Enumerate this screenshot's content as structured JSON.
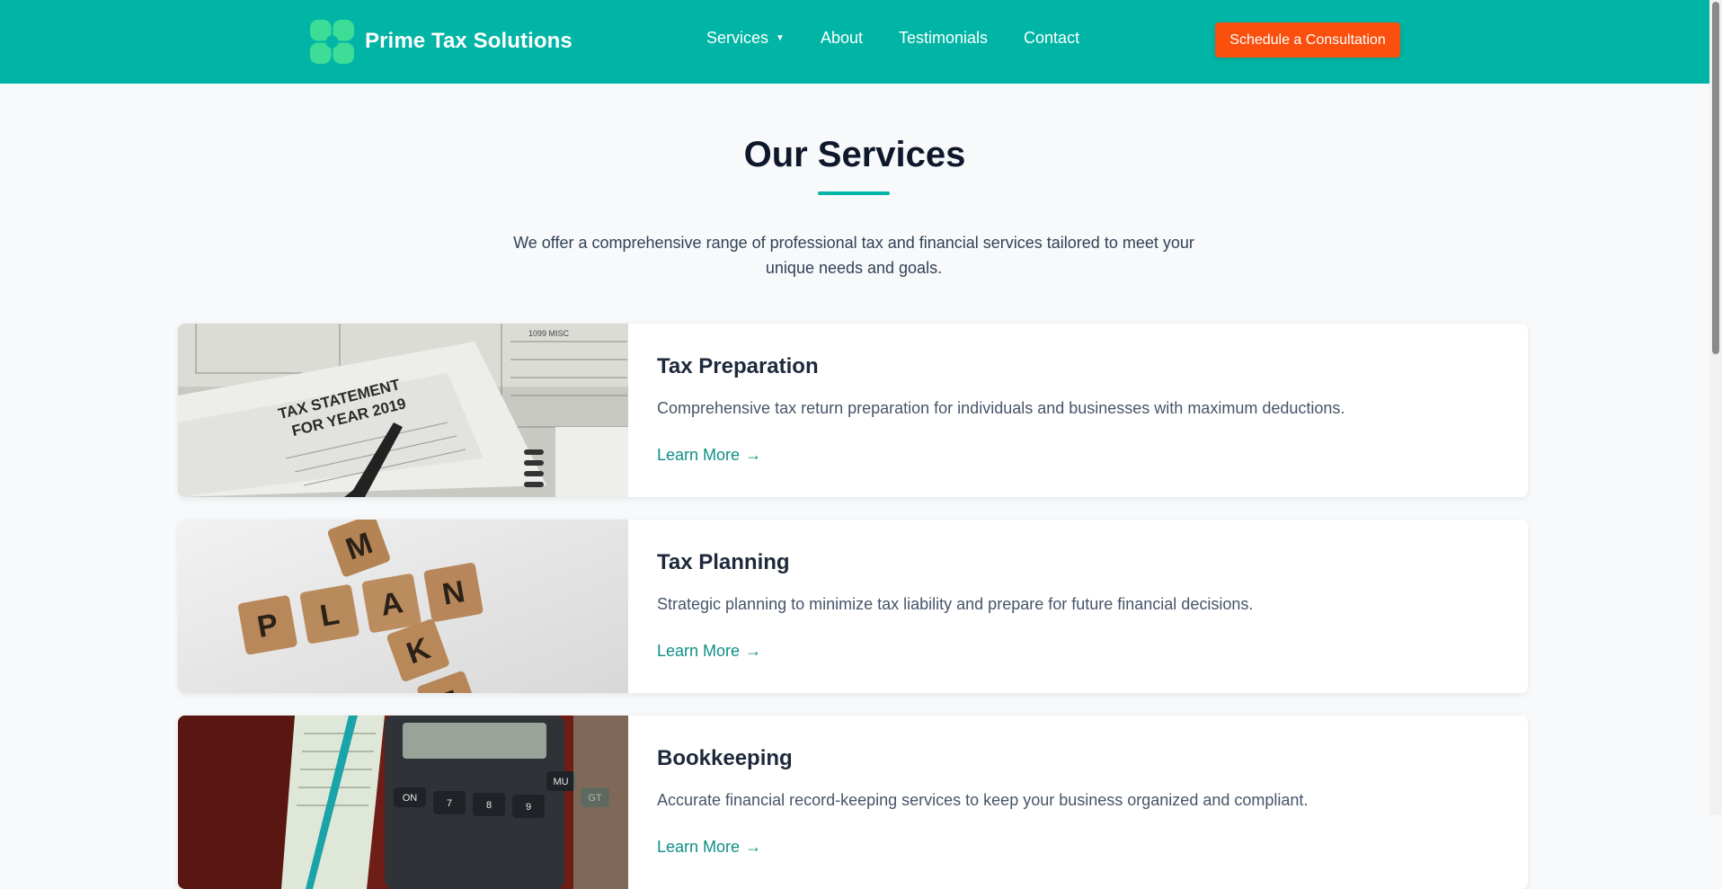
{
  "header": {
    "brand": "Prime Tax Solutions",
    "nav": [
      {
        "label": "Services",
        "has_dropdown": true
      },
      {
        "label": "About"
      },
      {
        "label": "Testimonials"
      },
      {
        "label": "Contact"
      }
    ],
    "cta_label": "Schedule a Consultation",
    "colors": {
      "bar": "#00b5a5",
      "cta": "#fa4f0d",
      "logo": "#3ddc97"
    }
  },
  "section": {
    "title": "Our Services",
    "intro": "We offer a comprehensive range of professional tax and financial services tailored to meet your unique needs and goals."
  },
  "services": [
    {
      "title": "Tax Preparation",
      "description": "Comprehensive tax return preparation for individuals and businesses with maximum deductions.",
      "link": "Learn More",
      "image_text": [
        "TAX STATEMENT",
        "FOR YEAR 2019",
        "1099 MISC"
      ]
    },
    {
      "title": "Tax Planning",
      "description": "Strategic planning to minimize tax liability and prepare for future financial decisions.",
      "link": "Learn More",
      "tiles_across": [
        "P",
        "L",
        "A",
        "N"
      ],
      "tiles_down": [
        "M",
        "A",
        "K",
        "E"
      ]
    },
    {
      "title": "Bookkeeping",
      "description": "Accurate financial record-keeping services to keep your business organized and compliant.",
      "link": "Learn More",
      "calculator_keys": [
        "ON",
        "7",
        "8",
        "9",
        "MU",
        "GT"
      ]
    }
  ],
  "icons": {
    "logo": "clover-logo-icon",
    "caret": "caret-down-icon",
    "arrow": "arrow-right-icon"
  }
}
